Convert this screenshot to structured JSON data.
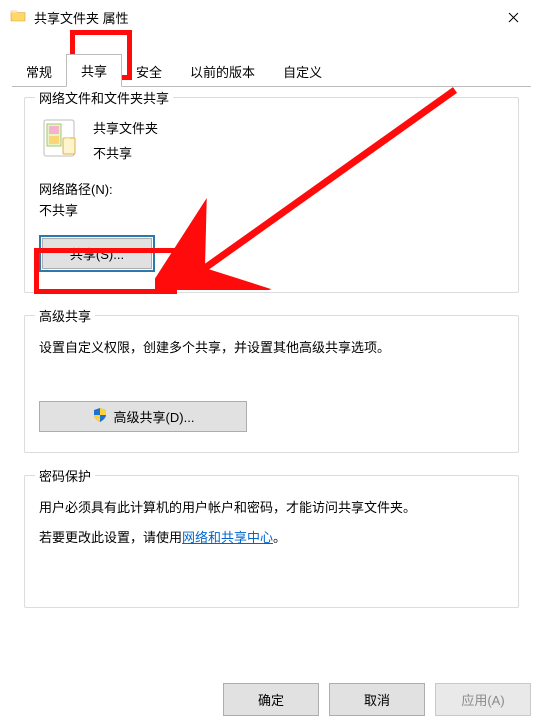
{
  "window": {
    "title": "共享文件夹 属性"
  },
  "tabs": {
    "items": [
      {
        "label": "常规"
      },
      {
        "label": "共享"
      },
      {
        "label": "安全"
      },
      {
        "label": "以前的版本"
      },
      {
        "label": "自定义"
      }
    ],
    "active_index": 1
  },
  "network_sharing": {
    "legend": "网络文件和文件夹共享",
    "folder_name": "共享文件夹",
    "status": "不共享",
    "path_label": "网络路径(N):",
    "path_value": "不共享",
    "share_button": "共享(S)..."
  },
  "advanced_sharing": {
    "legend": "高级共享",
    "description": "设置自定义权限，创建多个共享，并设置其他高级共享选项。",
    "button": "高级共享(D)..."
  },
  "password": {
    "legend": "密码保护",
    "line1": "用户必须具有此计算机的用户帐户和密码，才能访问共享文件夹。",
    "line2_prefix": "若要更改此设置，请使用",
    "link": "网络和共享中心",
    "line2_suffix": "。"
  },
  "footer": {
    "ok": "确定",
    "cancel": "取消",
    "apply": "应用(A)"
  }
}
